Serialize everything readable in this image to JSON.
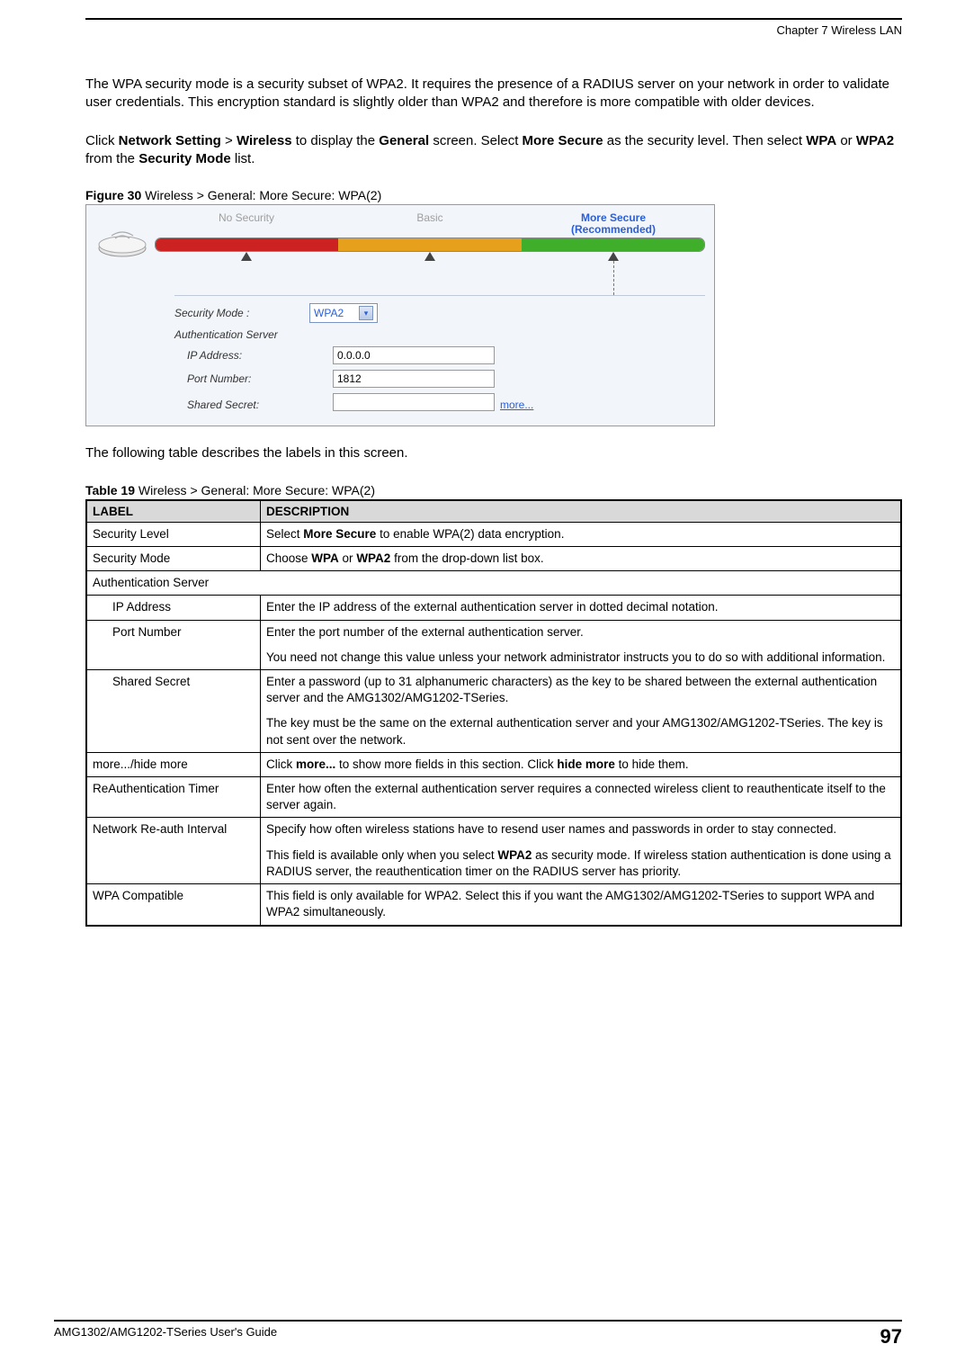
{
  "header": {
    "chapter": "Chapter 7 Wireless LAN"
  },
  "intro1": "The WPA security mode is a security subset of WPA2. It requires the presence of a RADIUS server on your network in order to validate user credentials. This encryption standard is slightly older than WPA2 and therefore is more compatible with older devices.",
  "intro2": {
    "prefix": "Click ",
    "b1": "Network Setting",
    "gt1": " > ",
    "b2": "Wireless",
    "mid1": " to display the ",
    "b3": "General",
    "mid2": " screen. Select ",
    "b4": "More Secure",
    "mid3": " as the security level. Then select ",
    "b5": "WPA",
    "or": " or ",
    "b6": "WPA2",
    "mid4": " from the ",
    "b7": "Security Mode",
    "end": " list."
  },
  "figure_caption": {
    "label": "Figure 30",
    "text": "   Wireless > General: More Secure: WPA(2)"
  },
  "slider": {
    "no_security": "No Security",
    "basic": "Basic",
    "more_secure": "More Secure",
    "recommended": "(Recommended)"
  },
  "form": {
    "security_mode_lbl": "Security Mode :",
    "security_mode_val": "WPA2",
    "auth_server": "Authentication Server",
    "ip_lbl": "IP Address:",
    "ip_val": "0.0.0.0",
    "port_lbl": "Port Number:",
    "port_val": "1812",
    "secret_lbl": "Shared Secret:",
    "secret_val": "",
    "more": "more..."
  },
  "after_fig": "The following table describes the labels in this screen.",
  "table_caption": {
    "label": "Table 19",
    "text": "   Wireless > General: More Secure: WPA(2)"
  },
  "th": {
    "label": "LABEL",
    "desc": "DESCRIPTION"
  },
  "rows": {
    "r1": {
      "l": "Security Level",
      "d_pre": "Select ",
      "d_b": "More Secure",
      "d_post": " to enable WPA(2) data encryption."
    },
    "r2": {
      "l": "Security Mode",
      "d_pre": "Choose ",
      "d_b1": "WPA",
      "d_or": " or ",
      "d_b2": "WPA2",
      "d_post": " from the drop-down list box."
    },
    "r3": {
      "l": "Authentication Server"
    },
    "r4": {
      "l": "IP Address",
      "d": "Enter the IP address of the external authentication server in dotted decimal notation."
    },
    "r5": {
      "l": "Port Number",
      "d1": "Enter the port number of the external authentication server.",
      "d2": "You need not change this value unless your network administrator instructs you to do so with additional information."
    },
    "r6": {
      "l": "Shared Secret",
      "d1": "Enter a password (up to 31 alphanumeric characters) as the key to be shared between the external authentication server and the AMG1302/AMG1202-TSeries.",
      "d2": "The key must be the same on the external authentication server and your AMG1302/AMG1202-TSeries. The key is not sent over the network."
    },
    "r7": {
      "l": "more.../hide more",
      "d_pre": "Click ",
      "d_b1": "more...",
      "d_mid": " to show more fields in this section. Click ",
      "d_b2": "hide more",
      "d_post": " to hide them."
    },
    "r8": {
      "l": "ReAuthentication Timer",
      "d": "Enter how often the external authentication server requires a connected wireless client to reauthenticate itself to the server again."
    },
    "r9": {
      "l": "Network Re-auth Interval",
      "d1": "Specify how often wireless stations have to resend user names and passwords in order to stay connected.",
      "d2_pre": "This field is available only when you select ",
      "d2_b": "WPA2",
      "d2_post": " as security mode. If wireless station authentication is done using a RADIUS server, the reauthentication timer on the RADIUS server has priority."
    },
    "r10": {
      "l": "WPA Compatible",
      "d": "This field is only available for WPA2. Select this if you want the AMG1302/AMG1202-TSeries to support WPA and WPA2 simultaneously."
    }
  },
  "footer": {
    "guide": "AMG1302/AMG1202-TSeries User's Guide",
    "page": "97"
  }
}
